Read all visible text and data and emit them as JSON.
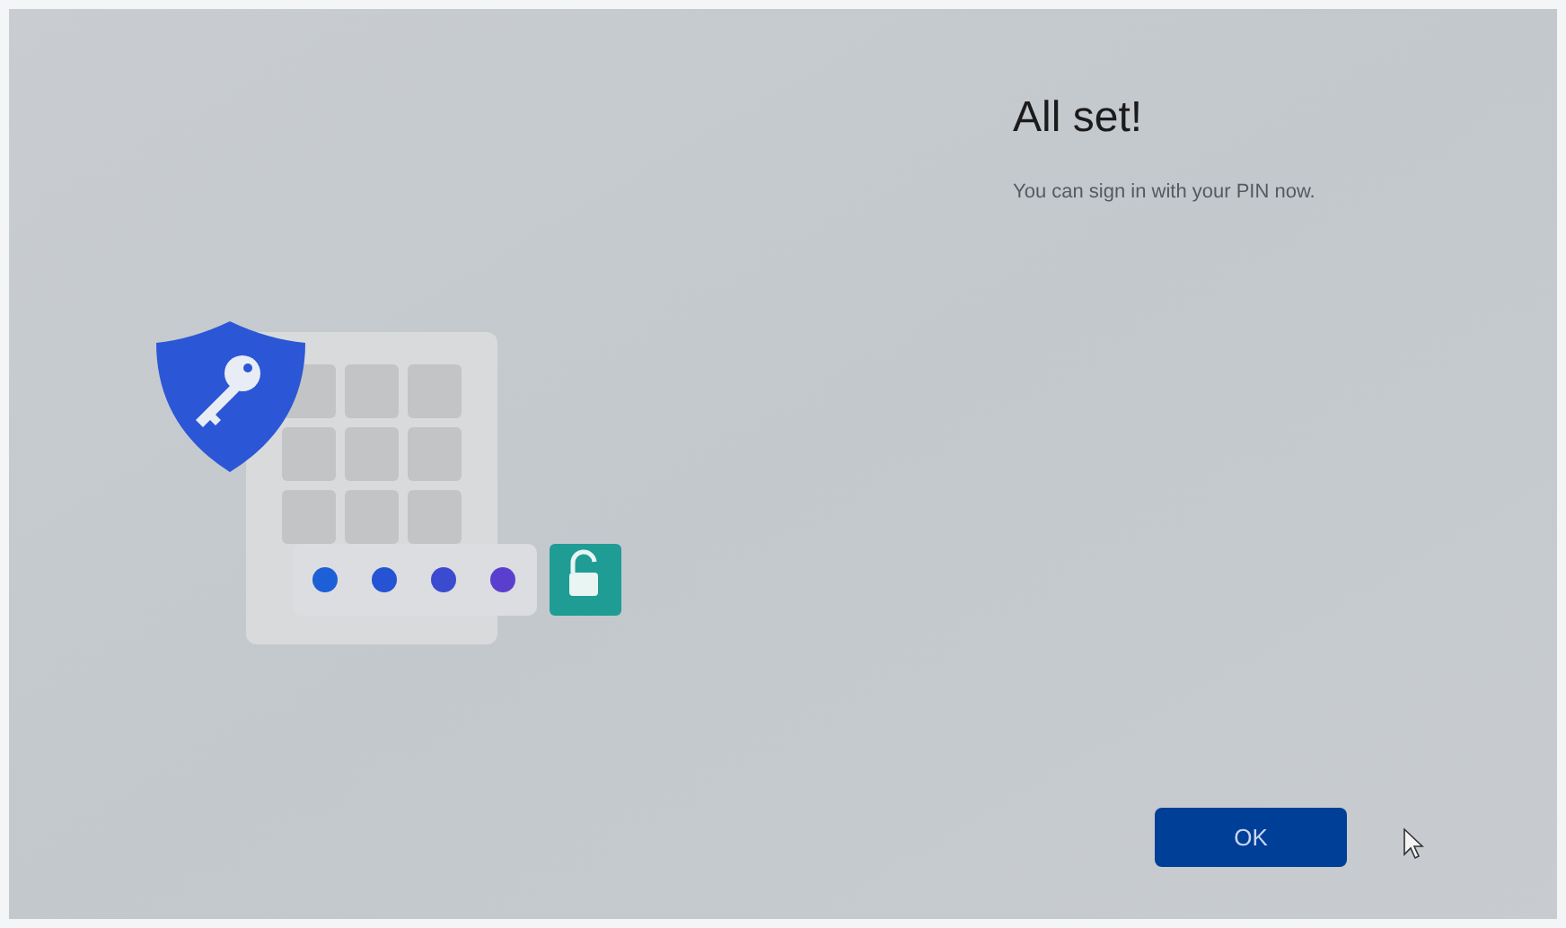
{
  "title": "All set!",
  "message": "You can sign in with your PIN now.",
  "pin_dots": [
    {
      "color": "#1d5fd6"
    },
    {
      "color": "#2553d4"
    },
    {
      "color": "#3b4bd0"
    },
    {
      "color": "#5a3fcf"
    }
  ],
  "buttons": [
    {
      "label": "OK"
    }
  ]
}
